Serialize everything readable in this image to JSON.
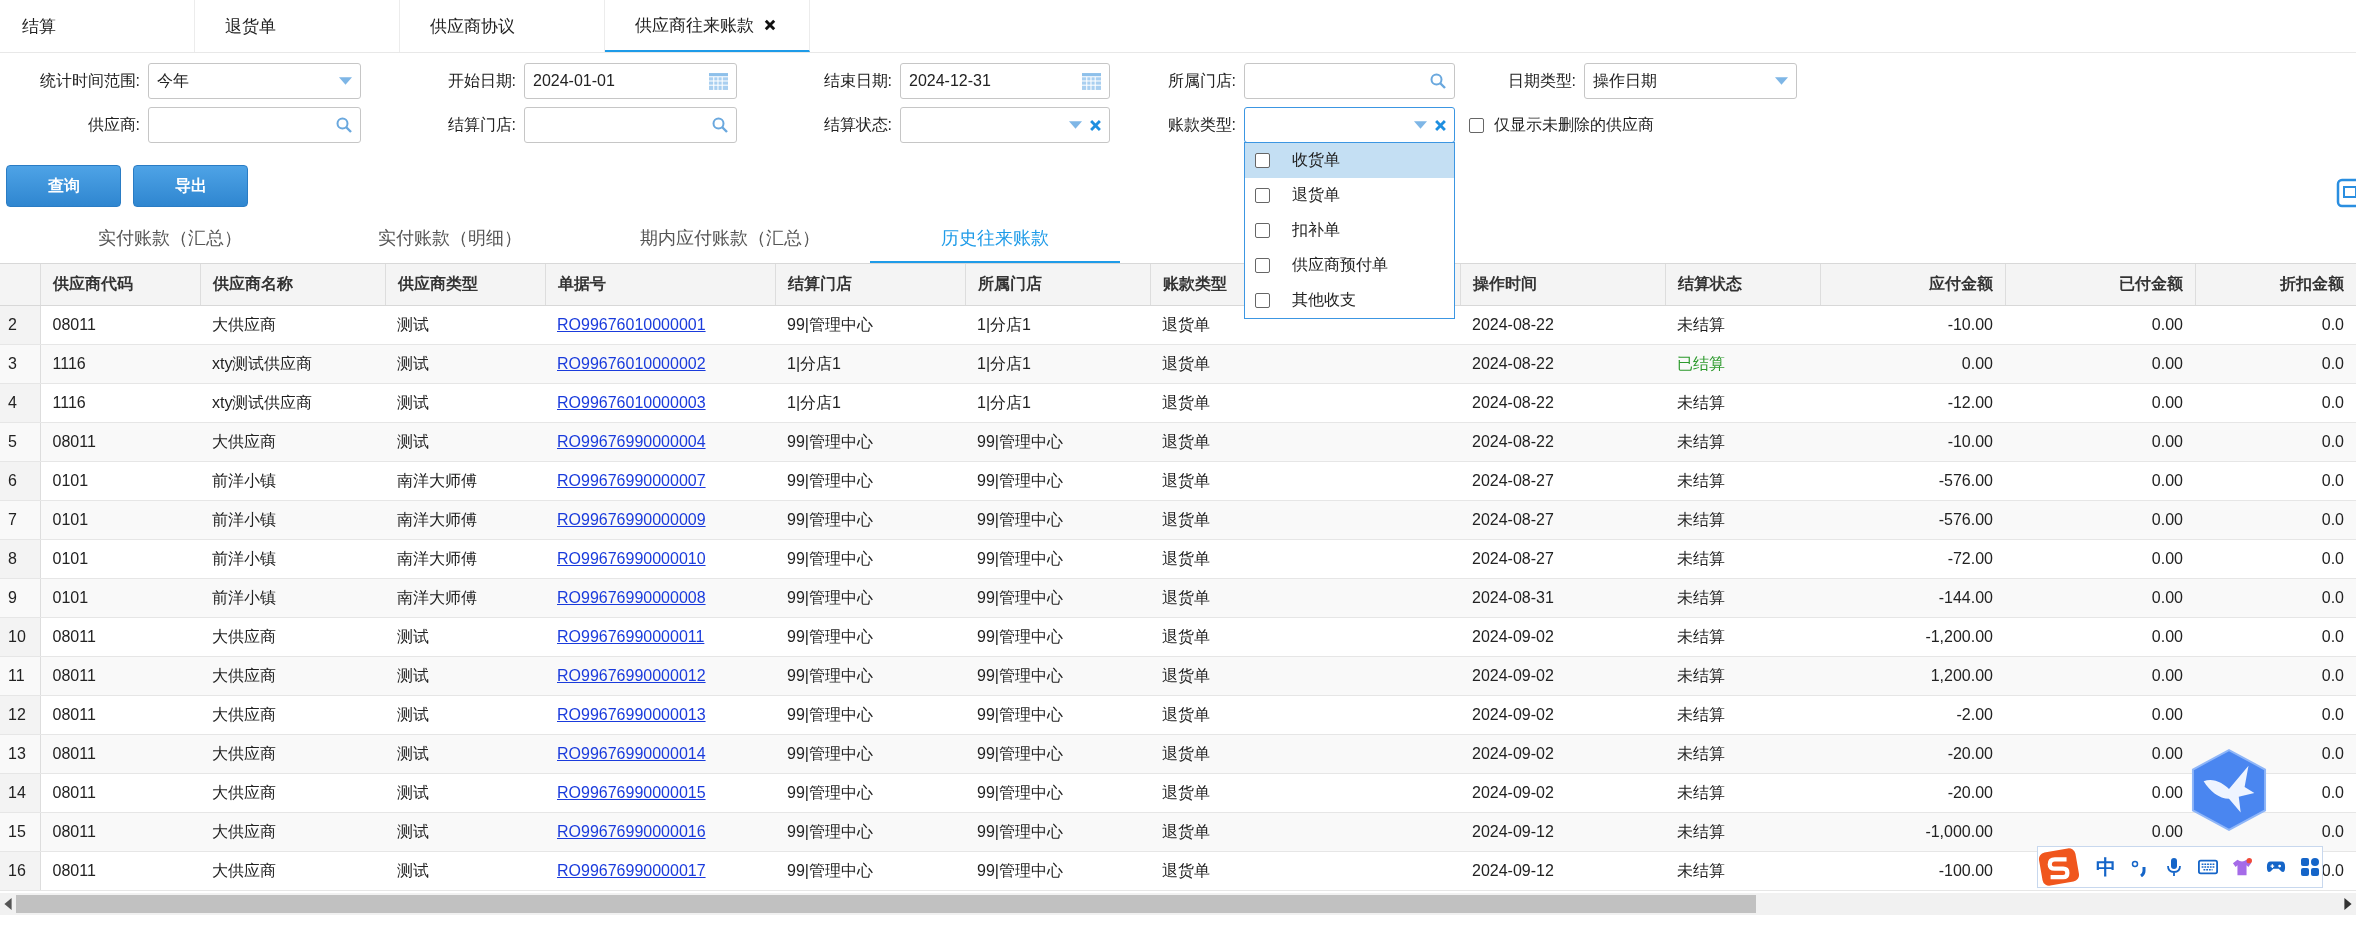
{
  "tabs": [
    {
      "label": "结算",
      "selected": false,
      "closable": false
    },
    {
      "label": "退货单",
      "selected": false,
      "closable": false
    },
    {
      "label": "供应商协议",
      "selected": false,
      "closable": false
    },
    {
      "label": "供应商往来账款",
      "selected": true,
      "closable": true
    }
  ],
  "filters": [
    {
      "label": "统计时间范围:",
      "kind": "select",
      "value": "今年",
      "focused": false
    },
    {
      "label": "开始日期:",
      "kind": "date",
      "value": "2024-01-01",
      "focused": false
    },
    {
      "label": "结束日期:",
      "kind": "date",
      "value": "2024-12-31",
      "focused": false
    },
    {
      "label": "所属门店:",
      "kind": "search",
      "focused": false
    },
    {
      "label": "日期类型:",
      "kind": "select",
      "value": "操作日期",
      "focused": false
    },
    {
      "label": "供应商:",
      "kind": "search",
      "focused": false
    },
    {
      "label": "结算门店:",
      "kind": "search",
      "focused": false
    },
    {
      "label": "结算状态:",
      "kind": "select-clear",
      "focused": false
    },
    {
      "label": "账款类型:",
      "kind": "select-clear",
      "focused": true,
      "options": [
        {
          "label": "收货单",
          "checked": false,
          "highlighted": true
        },
        {
          "label": "退货单",
          "checked": false,
          "highlighted": false
        },
        {
          "label": "扣补单",
          "checked": false,
          "highlighted": false
        },
        {
          "label": "供应商预付单",
          "checked": false,
          "highlighted": false
        },
        {
          "label": "其他收支",
          "checked": false,
          "highlighted": false
        }
      ]
    },
    {
      "label": "仅显示未删除的供应商",
      "kind": "checkbox",
      "checked": false
    }
  ],
  "buttons": [
    "查询",
    "导出"
  ],
  "subtabs": [
    {
      "label": "实付账款（汇总）",
      "selected": false
    },
    {
      "label": "实付账款（明细）",
      "selected": false
    },
    {
      "label": "期内应付账款（汇总）",
      "selected": false
    },
    {
      "label": "历史往来账款",
      "selected": true
    }
  ],
  "table": {
    "columns": [
      "供应商代码",
      "供应商名称",
      "供应商类型",
      "单据号",
      "结算门店",
      "所属门店",
      "账款类型",
      "操作时间",
      "结算状态",
      "应付金额",
      "已付金额",
      "折扣金额"
    ],
    "rows": [
      {
        "no": "2",
        "cells": [
          "08011",
          "大供应商",
          "测试",
          "RO99676010000001",
          "99|管理中心",
          "1|分店1",
          "退货单",
          "2024-08-22",
          "未结算",
          "-10.00",
          "0.00",
          "0.0"
        ],
        "settled": false
      },
      {
        "no": "3",
        "cells": [
          "1116",
          "xty测试供应商",
          "测试",
          "RO99676010000002",
          "1|分店1",
          "1|分店1",
          "退货单",
          "2024-08-22",
          "已结算",
          "0.00",
          "0.00",
          "0.0"
        ],
        "settled": true
      },
      {
        "no": "4",
        "cells": [
          "1116",
          "xty测试供应商",
          "测试",
          "RO99676010000003",
          "1|分店1",
          "1|分店1",
          "退货单",
          "2024-08-22",
          "未结算",
          "-12.00",
          "0.00",
          "0.0"
        ],
        "settled": false
      },
      {
        "no": "5",
        "cells": [
          "08011",
          "大供应商",
          "测试",
          "RO99676990000004",
          "99|管理中心",
          "99|管理中心",
          "退货单",
          "2024-08-22",
          "未结算",
          "-10.00",
          "0.00",
          "0.0"
        ],
        "settled": false
      },
      {
        "no": "6",
        "cells": [
          "0101",
          "前洋小镇",
          "南洋大师傅",
          "RO99676990000007",
          "99|管理中心",
          "99|管理中心",
          "退货单",
          "2024-08-27",
          "未结算",
          "-576.00",
          "0.00",
          "0.0"
        ],
        "settled": false
      },
      {
        "no": "7",
        "cells": [
          "0101",
          "前洋小镇",
          "南洋大师傅",
          "RO99676990000009",
          "99|管理中心",
          "99|管理中心",
          "退货单",
          "2024-08-27",
          "未结算",
          "-576.00",
          "0.00",
          "0.0"
        ],
        "settled": false
      },
      {
        "no": "8",
        "cells": [
          "0101",
          "前洋小镇",
          "南洋大师傅",
          "RO99676990000010",
          "99|管理中心",
          "99|管理中心",
          "退货单",
          "2024-08-27",
          "未结算",
          "-72.00",
          "0.00",
          "0.0"
        ],
        "settled": false
      },
      {
        "no": "9",
        "cells": [
          "0101",
          "前洋小镇",
          "南洋大师傅",
          "RO99676990000008",
          "99|管理中心",
          "99|管理中心",
          "退货单",
          "2024-08-31",
          "未结算",
          "-144.00",
          "0.00",
          "0.0"
        ],
        "settled": false
      },
      {
        "no": "10",
        "cells": [
          "08011",
          "大供应商",
          "测试",
          "RO99676990000011",
          "99|管理中心",
          "99|管理中心",
          "退货单",
          "2024-09-02",
          "未结算",
          "-1,200.00",
          "0.00",
          "0.0"
        ],
        "settled": false
      },
      {
        "no": "11",
        "cells": [
          "08011",
          "大供应商",
          "测试",
          "RO99676990000012",
          "99|管理中心",
          "99|管理中心",
          "退货单",
          "2024-09-02",
          "未结算",
          "1,200.00",
          "0.00",
          "0.0"
        ],
        "settled": false
      },
      {
        "no": "12",
        "cells": [
          "08011",
          "大供应商",
          "测试",
          "RO99676990000013",
          "99|管理中心",
          "99|管理中心",
          "退货单",
          "2024-09-02",
          "未结算",
          "-2.00",
          "0.00",
          "0.0"
        ],
        "settled": false
      },
      {
        "no": "13",
        "cells": [
          "08011",
          "大供应商",
          "测试",
          "RO99676990000014",
          "99|管理中心",
          "99|管理中心",
          "退货单",
          "2024-09-02",
          "未结算",
          "-20.00",
          "0.00",
          "0.0"
        ],
        "settled": false
      },
      {
        "no": "14",
        "cells": [
          "08011",
          "大供应商",
          "测试",
          "RO99676990000015",
          "99|管理中心",
          "99|管理中心",
          "退货单",
          "2024-09-02",
          "未结算",
          "-20.00",
          "0.00",
          "0.0"
        ],
        "settled": false
      },
      {
        "no": "15",
        "cells": [
          "08011",
          "大供应商",
          "测试",
          "RO99676990000016",
          "99|管理中心",
          "99|管理中心",
          "退货单",
          "2024-09-12",
          "未结算",
          "-1,000.00",
          "0.00",
          "0.0"
        ],
        "settled": false
      },
      {
        "no": "16",
        "cells": [
          "08011",
          "大供应商",
          "测试",
          "RO99676990000017",
          "99|管理中心",
          "99|管理中心",
          "退货单",
          "2024-09-12",
          "未结算",
          "-100.00",
          null,
          "0.0"
        ],
        "settled": false
      }
    ]
  },
  "ime_bar": {
    "label": "中"
  }
}
